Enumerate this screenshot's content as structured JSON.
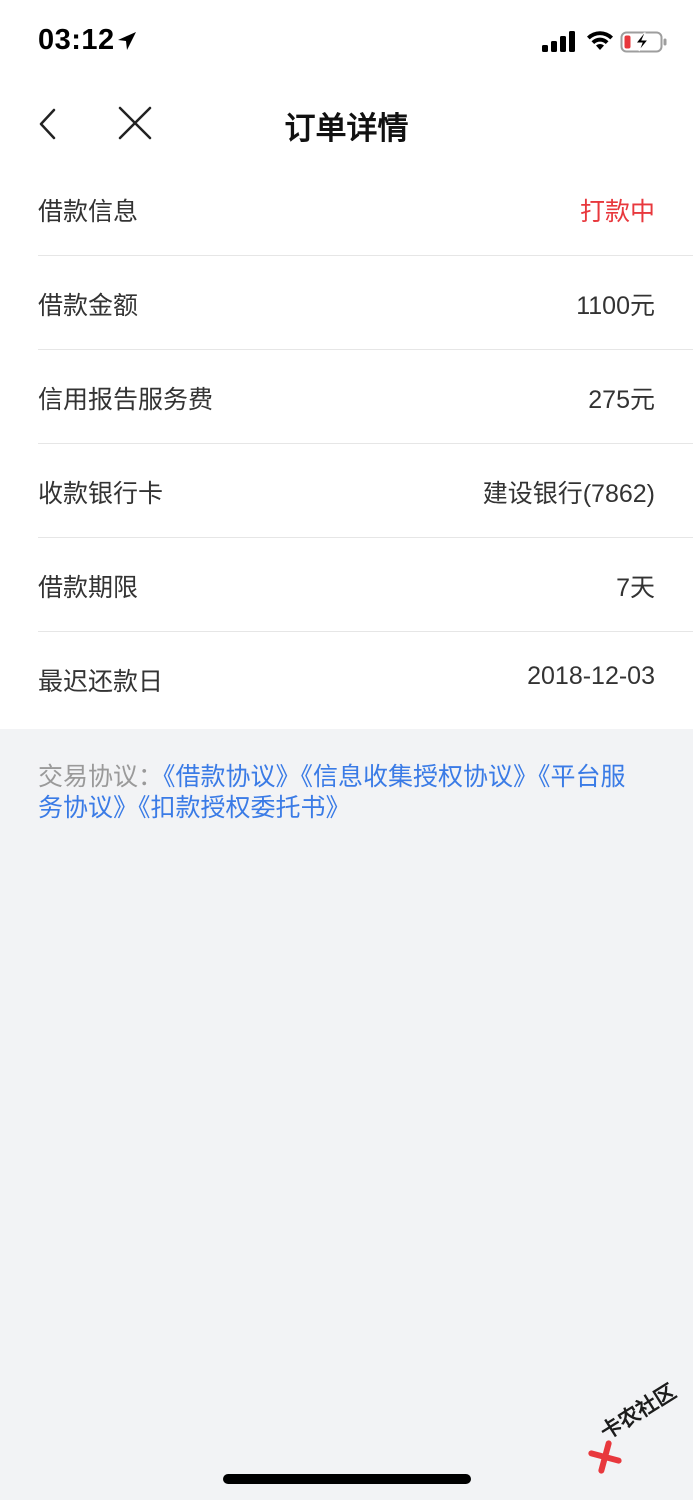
{
  "status_bar": {
    "time": "03:12",
    "icons": [
      "location-arrow-icon",
      "cellular-signal-icon",
      "wifi-icon",
      "battery-charging-icon"
    ],
    "battery_color": "#e8383d"
  },
  "nav": {
    "title": "订单详情",
    "back_icon": "chevron-left-icon",
    "close_icon": "close-icon"
  },
  "order_info": {
    "rows": [
      {
        "label": "借款信息",
        "value": "打款中",
        "value_color": "#e8383d"
      },
      {
        "label": "借款金额",
        "value": "1100元"
      },
      {
        "label": "信用报告服务费",
        "value": "275元"
      },
      {
        "label": "收款银行卡",
        "value": "建设银行(7862)"
      },
      {
        "label": "借款期限",
        "value": "7天"
      },
      {
        "label": "最迟还款日",
        "value": "2018-12-03"
      }
    ]
  },
  "agreements": {
    "prefix": "交易协议：",
    "links": [
      "《借款协议》",
      "《信息收集授权协议》",
      "《平台服务协议》",
      "《扣款授权委托书》"
    ],
    "link_color": "#3a7be6"
  },
  "watermark": {
    "text": "卡农社区"
  }
}
